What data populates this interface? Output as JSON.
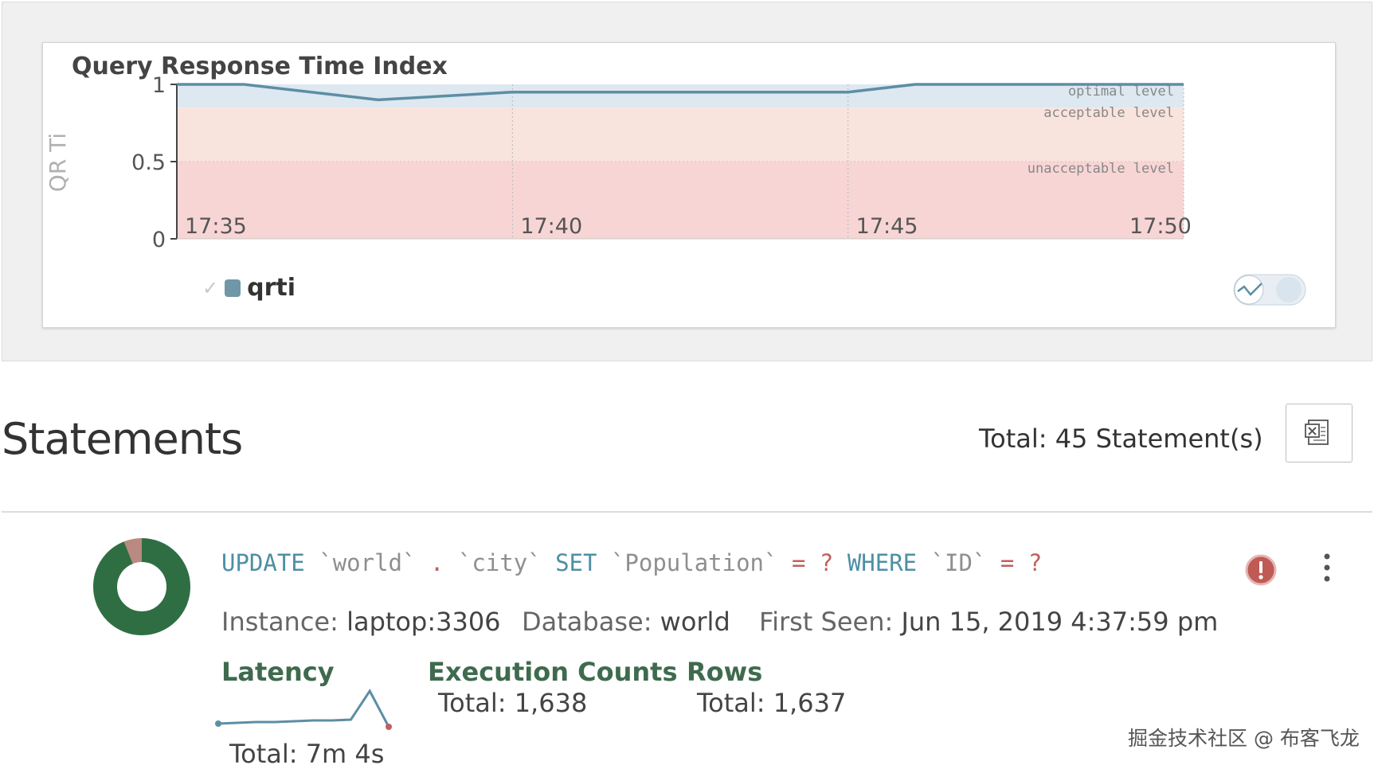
{
  "chart": {
    "title": "Query Response Time Index",
    "legend": {
      "label": "qrti"
    }
  },
  "chart_data": {
    "type": "line",
    "title": "Query Response Time Index",
    "ylabel": "QR Ti",
    "xlabel": "",
    "ylim": [
      0,
      1
    ],
    "y_ticks": [
      "1",
      "0.5",
      "0"
    ],
    "x_ticks": [
      "17:35",
      "17:40",
      "17:45",
      "17:50"
    ],
    "bands": [
      {
        "label": "optimal level",
        "from": 0.85,
        "to": 1.0,
        "color": "#dde8f1"
      },
      {
        "label": "acceptable level",
        "from": 0.5,
        "to": 0.85,
        "color": "#f9e3dd"
      },
      {
        "label": "unacceptable level",
        "from": 0.0,
        "to": 0.5,
        "color": "#f8d5d5"
      }
    ],
    "series": [
      {
        "name": "qrti",
        "color": "#5d8ea4",
        "x": [
          "17:35",
          "17:36",
          "17:38",
          "17:40",
          "17:42",
          "17:44",
          "17:45",
          "17:46",
          "17:48",
          "17:50"
        ],
        "values": [
          1.0,
          1.0,
          0.9,
          0.95,
          0.95,
          0.95,
          0.95,
          1.0,
          1.0,
          1.0
        ]
      }
    ],
    "grid": true,
    "legend_position": "bottom-left"
  },
  "statements": {
    "title": "Statements",
    "total_label": "Total: 45 Statement(s)",
    "export_icon": "excel-export-icon"
  },
  "statement": {
    "sql_tokens": [
      {
        "t": "UPDATE",
        "c": "kw"
      },
      {
        "t": " ",
        "c": ""
      },
      {
        "t": "`world`",
        "c": "id"
      },
      {
        "t": " ",
        "c": ""
      },
      {
        "t": ".",
        "c": "op"
      },
      {
        "t": " ",
        "c": ""
      },
      {
        "t": "`city`",
        "c": "id"
      },
      {
        "t": " ",
        "c": ""
      },
      {
        "t": "SET",
        "c": "kw"
      },
      {
        "t": " ",
        "c": ""
      },
      {
        "t": "`Population`",
        "c": "id"
      },
      {
        "t": " ",
        "c": ""
      },
      {
        "t": "=",
        "c": "op"
      },
      {
        "t": " ",
        "c": ""
      },
      {
        "t": "?",
        "c": "op"
      },
      {
        "t": " ",
        "c": ""
      },
      {
        "t": "WHERE",
        "c": "kw"
      },
      {
        "t": " ",
        "c": ""
      },
      {
        "t": "`ID`",
        "c": "id"
      },
      {
        "t": " ",
        "c": ""
      },
      {
        "t": "=",
        "c": "op"
      },
      {
        "t": " ",
        "c": ""
      },
      {
        "t": "?",
        "c": "op"
      }
    ],
    "instance_label": "Instance:",
    "instance_value": "laptop:3306",
    "database_label": "Database:",
    "database_value": "world",
    "first_seen_label": "First Seen:",
    "first_seen_value": "Jun 15, 2019 4:37:59 pm",
    "donut": {
      "share": 0.94,
      "main_color": "#2f6e43",
      "rest_color": "#b98a80"
    },
    "latency": {
      "label": "Latency",
      "total": "Total: 7m 4s",
      "spark": [
        0.08,
        0.1,
        0.12,
        0.12,
        0.14,
        0.16,
        0.16,
        0.18,
        0.9,
        0.0
      ],
      "color": "#5d8ea4",
      "end_color": "#c0605e"
    },
    "execution": {
      "label": "Execution Counts",
      "total": "Total: 1,638"
    },
    "rows": {
      "label": "Rows",
      "total": "Total: 1,637"
    }
  },
  "watermark": "掘金技术社区 @ 布客飞龙"
}
